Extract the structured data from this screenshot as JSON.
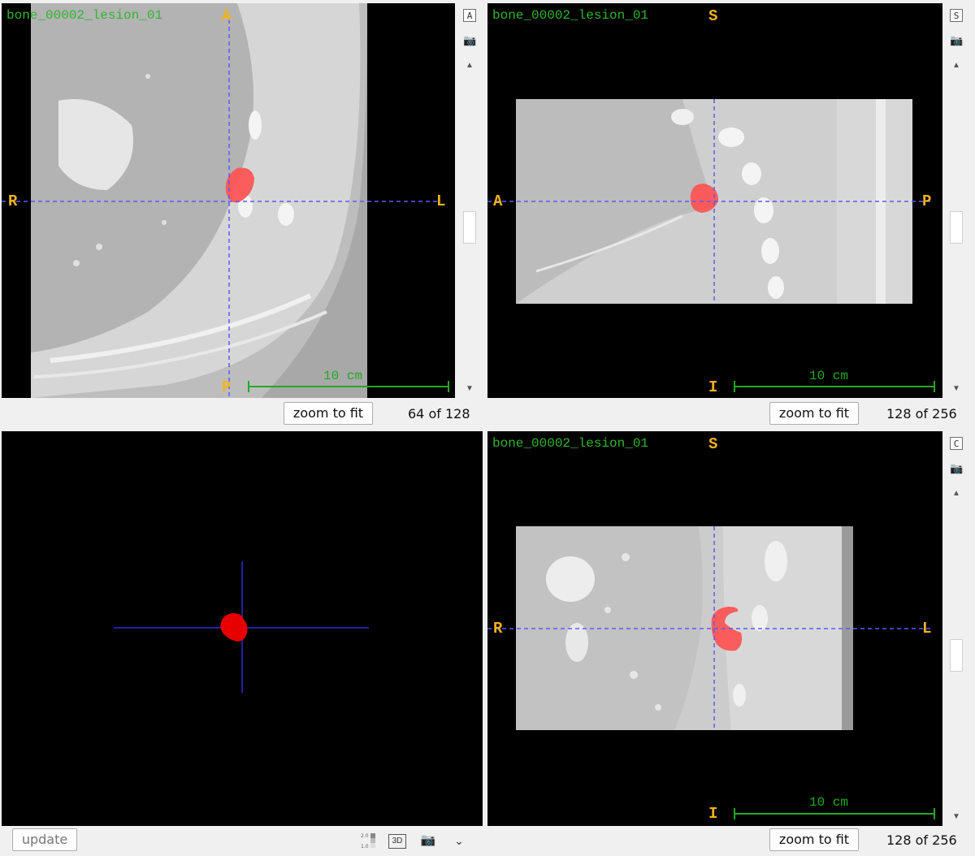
{
  "axial": {
    "title": "bone_00002_lesion_01",
    "top": "A",
    "bottom": "P",
    "left": "R",
    "right": "L",
    "view_button": "A",
    "scale_label": "10 cm",
    "zoom_label": "zoom to fit",
    "slice_text": "64 of 128",
    "slider_fraction": 0.5
  },
  "sagittal": {
    "title": "bone_00002_lesion_01",
    "top": "S",
    "bottom": "I",
    "left": "A",
    "right": "P",
    "view_button": "S",
    "scale_label": "10 cm",
    "zoom_label": "zoom to fit",
    "slice_text": "128 of 256",
    "slider_fraction": 0.5
  },
  "coronal": {
    "title": "bone_00002_lesion_01",
    "top": "S",
    "bottom": "I",
    "left": "R",
    "right": "L",
    "view_button": "C",
    "scale_label": "10 cm",
    "zoom_label": "zoom to fit",
    "slice_text": "128 of 256",
    "slider_fraction": 0.5
  },
  "render3d": {
    "update_label": "update",
    "icons": [
      "window-level-icon",
      "3d-icon",
      "camera-icon",
      "chevron-down-icon"
    ],
    "three_d_label": "3D",
    "wl_top": "2.0",
    "wl_bottom": "1.0"
  },
  "colors": {
    "orientation": "#f3b21b",
    "title": "#2fb62f",
    "crosshair": "#5a5aff",
    "lesion": "#ff4d4d",
    "lesion_3d": "#e60000",
    "scale_bar": "#22aa22"
  }
}
